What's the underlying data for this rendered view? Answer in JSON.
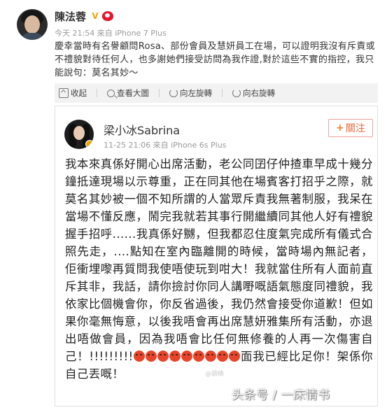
{
  "outer_post": {
    "author": "陳法蓉",
    "meta": "今天 21:54 來自 iPhone 7 Plus",
    "body": "慶幸當時有名譽顧問Rosa、部份會員及慧妍員工在場，可以證明我沒有斥責或不禮貌對待任何人，也多謝她們接受訪問為我作證,對於這些不實的指控，我只能說句：莫名其妙～",
    "toolbar": {
      "collapse_label": "收起",
      "view_large_label": "查看大圖",
      "rotate_left_label": "向左旋轉",
      "rotate_right_label": "向右旋轉"
    }
  },
  "card": {
    "author": "梁小冰Sabrina",
    "meta": "11-25 21:06  來自 iPhone 6s Plus",
    "follow_label": "關注",
    "body_main": "我本來真係好開心出席活動，老公同囝仔仲揸車早成十幾分鐘抵達現場以示尊重，正在同其他在場賓客打招乎之際，就莫名其妙被一個不知所謂的人當眾斥責我無著制服，我呆在當場不懂反應，鬧完我就若其事行開繼續同其他人好有禮貌握手招呼......我真係好嬲，但我都忍住度氣完成所有儀式合照先走，....點知在室內臨離開的時候，當時場內無記者，佢衝埋嚟再質問我使唔使玩到咁大！我就當住所有人面前直斥其非，我話，請你撿討你同人講嘢嘅語氣態度同禮貌，我依家比個機會你，你反省過後，我仍然會接受你道歉！但如果你毫無悔意，以後我唔會再出席慧妍雅集所有活動，亦退出唔做會員，因為我唔會比任何無修養的人再一次傷害自己！!!!!!!!!!",
    "body_tail": "面我已經比足你！架係你自己丟嘅！",
    "angry_emoji_count": 9
  },
  "watermark": {
    "small": "@頭條",
    "main": "头条号 / 一床情书"
  }
}
